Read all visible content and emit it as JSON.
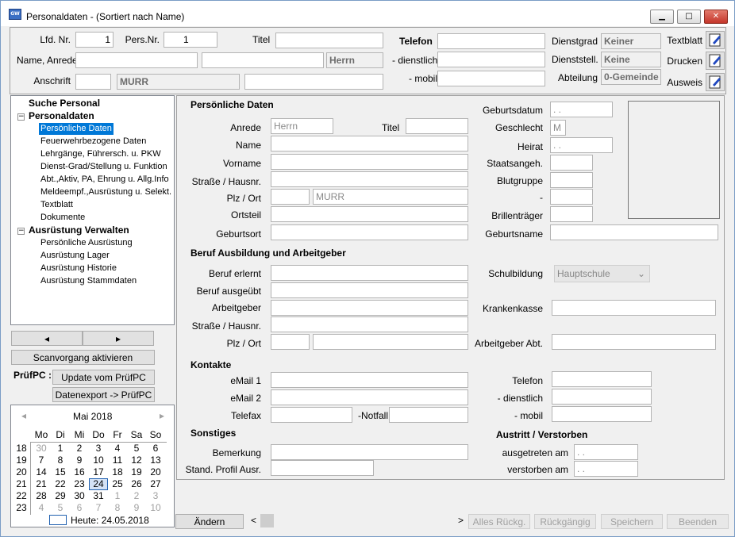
{
  "window": {
    "title": "Personaldaten - (Sortiert nach Name)"
  },
  "header": {
    "lfd_nr_label": "Lfd. Nr.",
    "lfd_nr_value": "1",
    "pers_nr_label": "Pers.Nr.",
    "pers_nr_value": "1",
    "titel_label": "Titel",
    "titel_value": "",
    "name_label": "Name, Anrede",
    "anrede_value": "Herrn",
    "anschrift_label": "Anschrift",
    "ort_value": "MURR",
    "telefon_label": "Telefon",
    "dienstlich_label": "- dienstlich",
    "mobil_label": "- mobil",
    "dienstgrad_label": "Dienstgrad",
    "dienstgrad_value": "Keiner",
    "dienststell_label": "Dienststell.",
    "dienststell_value": "Keine",
    "abteilung_label": "Abteilung",
    "abteilung_value": "0-Gemeinde",
    "textblatt_label": "Textblatt",
    "drucken_label": "Drucken",
    "ausweis_label": "Ausweis"
  },
  "tree": {
    "items": [
      {
        "label": "Suche Personal"
      },
      {
        "label": "Personaldaten"
      },
      {
        "label": "Persönliche Daten"
      },
      {
        "label": "Feuerwehrbezogene Daten"
      },
      {
        "label": "Lehrgänge, Führersch. u. PKW"
      },
      {
        "label": "Dienst-Grad/Stellung u. Funktion"
      },
      {
        "label": "Abt.,Aktiv, PA, Ehrung u. Allg.Info"
      },
      {
        "label": "Meldeempf.,Ausrüstung u. Selekt."
      },
      {
        "label": "Textblatt"
      },
      {
        "label": "Dokumente"
      },
      {
        "label": "Ausrüstung Verwalten"
      },
      {
        "label": "Persönliche Ausrüstung"
      },
      {
        "label": "Ausrüstung Lager"
      },
      {
        "label": "Ausrüstung Historie"
      },
      {
        "label": "Ausrüstung Stammdaten"
      }
    ]
  },
  "left_buttons": {
    "prev": "◂",
    "next": "▸",
    "scan": "Scanvorgang aktivieren",
    "pruefpc_label": "PrüfPC :",
    "update": "Update vom PrüfPC",
    "export": "Datenexport -> PrüfPC"
  },
  "calendar": {
    "month": "Mai 2018",
    "prev": "◂",
    "next": "▸",
    "weekdays": [
      "Mo",
      "Di",
      "Mi",
      "Do",
      "Fr",
      "Sa",
      "So"
    ],
    "weeks": [
      {
        "kw": "18",
        "days": [
          "30",
          "1",
          "2",
          "3",
          "4",
          "5",
          "6"
        ]
      },
      {
        "kw": "19",
        "days": [
          "7",
          "8",
          "9",
          "10",
          "11",
          "12",
          "13"
        ]
      },
      {
        "kw": "20",
        "days": [
          "14",
          "15",
          "16",
          "17",
          "18",
          "19",
          "20"
        ]
      },
      {
        "kw": "21",
        "days": [
          "21",
          "22",
          "23",
          "24",
          "25",
          "26",
          "27"
        ]
      },
      {
        "kw": "22",
        "days": [
          "28",
          "29",
          "30",
          "31",
          "1",
          "2",
          "3"
        ]
      },
      {
        "kw": "23",
        "days": [
          "4",
          "5",
          "6",
          "7",
          "8",
          "9",
          "10"
        ]
      }
    ],
    "today": "Heute: 24.05.2018"
  },
  "main": {
    "persoenlich": {
      "heading": "Persönliche Daten",
      "anrede": "Anrede",
      "anrede_value": "Herrn",
      "titel": "Titel",
      "name": "Name",
      "vorname": "Vorname",
      "strasse": "Straße / Hausnr.",
      "plz_ort": "Plz / Ort",
      "ort_value": "MURR",
      "ortsteil": "Ortsteil",
      "geburtsort": "Geburtsort",
      "geburtsdatum": "Geburtsdatum",
      "geburtsdatum_value": ".  .",
      "geschlecht": "Geschlecht",
      "geschlecht_value": "M",
      "heirat": "Heirat",
      "heirat_value": ".  .",
      "staatsangeh": "Staatsangeh.",
      "blutgruppe": "Blutgruppe",
      "dash": "-",
      "brillentraeger": "Brillenträger",
      "geburtsname": "Geburtsname"
    },
    "beruf": {
      "heading": "Beruf Ausbildung und Arbeitgeber",
      "erlernt": "Beruf erlernt",
      "ausgeuebt": "Beruf ausgeübt",
      "arbeitgeber": "Arbeitgeber",
      "strasse": "Straße / Hausnr.",
      "plz_ort": "Plz / Ort",
      "schulbildung": "Schulbildung",
      "schulbildung_value": "Hauptschule",
      "krankenkasse": "Krankenkasse",
      "arbeitgeber_abt": "Arbeitgeber Abt."
    },
    "kontakte": {
      "heading": "Kontakte",
      "email1": "eMail 1",
      "email2": "eMail 2",
      "telefax": "Telefax",
      "notfall": "-Notfall",
      "telefon": "Telefon",
      "dienstlich": "- dienstlich",
      "mobil": "- mobil"
    },
    "sonstiges": {
      "heading": "Sonstiges",
      "bemerkung": "Bemerkung",
      "stand": "Stand. Profil Ausr.",
      "austritt_heading": "Austritt / Verstorben",
      "ausgetreten": "ausgetreten am",
      "ausgetreten_value": ".  .",
      "verstorben": "verstorben am",
      "verstorben_value": ".  ."
    }
  },
  "bottom": {
    "aendern": "Ändern",
    "scroll_left": "<",
    "scroll_right": ">",
    "alles": "Alles Rückg.",
    "rueckgaengig": "Rückgängig",
    "speichern": "Speichern",
    "beenden": "Beenden"
  }
}
